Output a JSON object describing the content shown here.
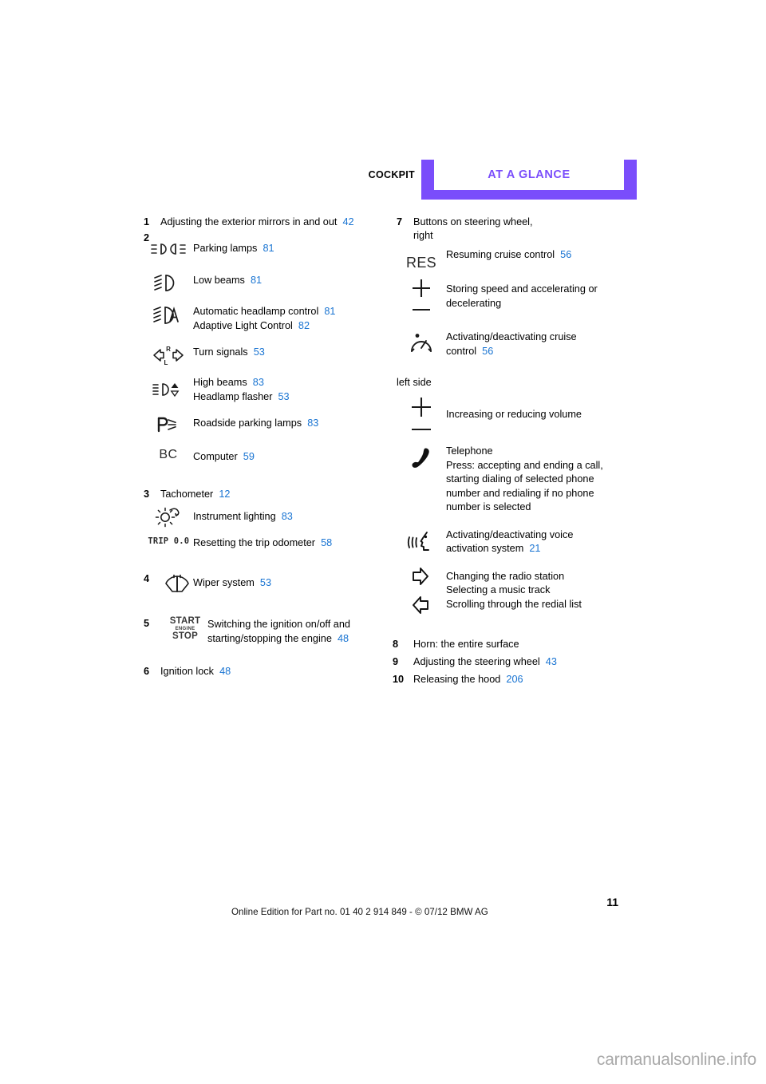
{
  "header": {
    "cockpit_label": "COCKPIT",
    "glance_label": "AT A GLANCE",
    "accent_color": "#7a4dfb"
  },
  "left_column": [
    {
      "number": "1",
      "label": "Adjusting the exterior mirrors in and out",
      "page": "42"
    },
    {
      "number": "2",
      "label": "",
      "subitems": [
        {
          "icon": "parking-lamps-icon",
          "lines": [
            {
              "text": "Parking lamps",
              "page": "81"
            }
          ]
        },
        {
          "icon": "low-beams-icon",
          "lines": [
            {
              "text": "Low beams",
              "page": "81"
            }
          ]
        },
        {
          "icon": "automatic-headlamp-control-icon",
          "lines": [
            {
              "text": "Automatic headlamp control",
              "page": "81"
            },
            {
              "text": "Adaptive Light Control",
              "page": "82"
            }
          ]
        },
        {
          "icon": "turn-signals-icon",
          "lines": [
            {
              "text": "Turn signals",
              "page": "53"
            }
          ]
        },
        {
          "icon": "high-beams-icon",
          "lines": [
            {
              "text": "High beams",
              "page": "83"
            },
            {
              "text": "Headlamp flasher",
              "page": "53"
            }
          ]
        },
        {
          "icon": "roadside-parking-lamps-icon",
          "lines": [
            {
              "text": "Roadside parking lamps",
              "page": "83"
            }
          ]
        },
        {
          "icon": "computer-bc-icon",
          "lines": [
            {
              "text": "Computer",
              "page": "59"
            }
          ]
        }
      ]
    },
    {
      "number": "3",
      "label": "Tachometer",
      "page": "12",
      "subitems": [
        {
          "icon": "instrument-lighting-icon",
          "lines": [
            {
              "text": "Instrument lighting",
              "page": "83"
            }
          ]
        },
        {
          "icon": "trip-odometer-icon",
          "icon_text": "TRIP 0.0",
          "lines": [
            {
              "text": "Resetting the trip odometer",
              "page": "58"
            }
          ]
        }
      ]
    },
    {
      "number": "4",
      "label": "",
      "subitems": [
        {
          "icon": "wiper-system-icon",
          "lines": [
            {
              "text": "Wiper system",
              "page": "53"
            }
          ]
        }
      ]
    },
    {
      "number": "5",
      "icon": "start-stop-engine-icon",
      "icon_text_top": "START",
      "icon_text_mid": "ENGINE",
      "icon_text_bottom": "STOP",
      "lines": [
        {
          "text": "Switching the ignition on/off and",
          "page": ""
        },
        {
          "text": "starting/stopping the engine",
          "page": "48"
        }
      ]
    },
    {
      "number": "6",
      "label": "Ignition lock",
      "page": "48"
    }
  ],
  "right_column": {
    "item7": {
      "number": "7",
      "label_line1": "Buttons on steering wheel,",
      "label_line2": "right",
      "subitems": [
        {
          "icon": "res-button-icon",
          "icon_text": "RES",
          "lines": [
            {
              "text": "Resuming cruise control",
              "page": "56"
            }
          ]
        },
        {
          "icon": "plus-minus-rocker-icon",
          "lines": [
            {
              "text": "Storing speed and accelerating or",
              "page": ""
            },
            {
              "text": "decelerating",
              "page": ""
            }
          ]
        },
        {
          "icon": "cruise-control-icon",
          "lines": [
            {
              "text": "Activating/deactivating cruise",
              "page": ""
            },
            {
              "text": "control",
              "page": "56"
            }
          ]
        }
      ],
      "left_side_label": "left side",
      "left_side_subitems": [
        {
          "icon": "volume-plus-minus-icon",
          "lines": [
            {
              "text": "Increasing or reducing volume",
              "page": ""
            }
          ]
        },
        {
          "icon": "telephone-icon",
          "lines": [
            {
              "text": "Telephone",
              "page": ""
            },
            {
              "text": "Press: accepting and ending a call,",
              "page": ""
            },
            {
              "text": "starting dialing of selected phone",
              "page": ""
            },
            {
              "text": "number and redialing if no phone",
              "page": ""
            },
            {
              "text": "number is selected",
              "page": ""
            }
          ]
        },
        {
          "icon": "voice-activation-icon",
          "lines": [
            {
              "text": "Activating/deactivating voice",
              "page": ""
            },
            {
              "text": "activation system",
              "page": "21"
            }
          ]
        },
        {
          "icon": "arrow-right-left-icon",
          "lines": [
            {
              "text": "Changing the radio station",
              "page": ""
            },
            {
              "text": "Selecting a music track",
              "page": ""
            },
            {
              "text": "Scrolling through the redial list",
              "page": ""
            }
          ]
        }
      ]
    },
    "tail_items": [
      {
        "number": "8",
        "label": "Horn: the entire surface",
        "page": ""
      },
      {
        "number": "9",
        "label": "Adjusting the steering wheel",
        "page": "43"
      },
      {
        "number": "10",
        "label": "Releasing the hood",
        "page": "206"
      }
    ]
  },
  "footer": {
    "page_number": "11",
    "edition_line": "Online Edition for Part no. 01 40 2 914 849 - © 07/12 BMW AG",
    "watermark": "carmanualsonline.info"
  }
}
